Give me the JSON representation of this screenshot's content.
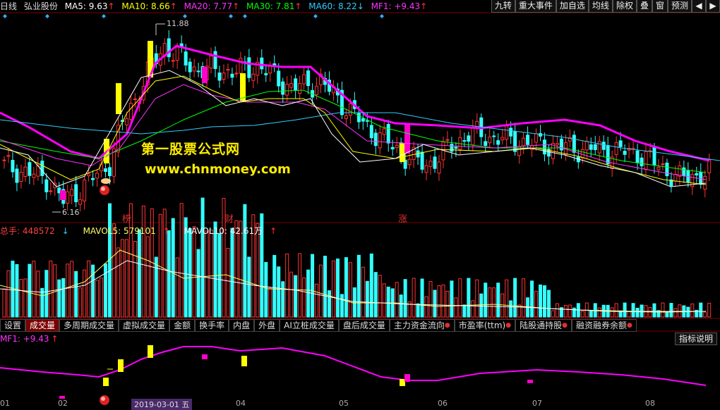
{
  "header": {
    "period": "日线",
    "stock": "弘业股份",
    "ma": [
      {
        "label": "MA5: 9.63",
        "arrow": "↑",
        "color": "#ffffff"
      },
      {
        "label": "MA10: 8.66",
        "arrow": "↑",
        "color": "#ffff00"
      },
      {
        "label": "MA20: 7.77",
        "arrow": "↑",
        "color": "#ff33ff"
      },
      {
        "label": "MA30: 7.81",
        "arrow": "↑",
        "color": "#00ff00"
      },
      {
        "label": "MA60: 8.22",
        "arrow": "↓",
        "color": "#33ccff"
      },
      {
        "label": "MF1: +9.43",
        "arrow": "↑",
        "color": "#ff33ff"
      }
    ]
  },
  "toolbar": {
    "jiuzhuan": "九转",
    "events": "重大事件",
    "add": "加自选",
    "ma_line": "均线",
    "exright": "除权",
    "overlay": "叠",
    "window": "窗",
    "alert": "预测",
    "left_arrow": "◀",
    "right_arrow": "▶"
  },
  "price_labels": {
    "high": "11.88",
    "low": "6.16"
  },
  "tags": {
    "bang": "榜",
    "cai": "财",
    "zhang": "涨"
  },
  "watermark": {
    "line1": "第一股票公式网",
    "line2": "www.chnmoney.com"
  },
  "volume": {
    "total": "总手: 448572",
    "total_arrow": "↓",
    "mavol5": "MAVOL5: 579101",
    "mavol5_arrow": "↑",
    "mavol10": "MAVOL10: 42.61万",
    "mavol10_arrow": "↑"
  },
  "tabs": [
    {
      "label": "设置",
      "dot": false
    },
    {
      "label": "成交量",
      "dot": false,
      "active": true
    },
    {
      "label": "多周期成交量",
      "dot": false
    },
    {
      "label": "虚拟成交量",
      "dot": false
    },
    {
      "label": "金额",
      "dot": false
    },
    {
      "label": "换手率",
      "dot": false
    },
    {
      "label": "内盘",
      "dot": false
    },
    {
      "label": "外盘",
      "dot": false
    },
    {
      "label": "AI立桩成交量",
      "dot": false
    },
    {
      "label": "盘后成交量",
      "dot": false
    },
    {
      "label": "主力资金流向",
      "dot": true
    },
    {
      "label": "市盈率(ttm)",
      "dot": true
    },
    {
      "label": "陆股通持股",
      "dot": true
    },
    {
      "label": "融资融券余额",
      "dot": true
    }
  ],
  "mf": {
    "label": "MF1: +9.43",
    "arrow": "↑"
  },
  "explain": "指标说明",
  "dates": [
    "01",
    "02",
    "2019-03-01 五",
    "04",
    "05",
    "06",
    "07",
    "08"
  ],
  "colors": {
    "up": "#ff3333",
    "down": "#33ffff",
    "ma5": "#ffffff",
    "ma10": "#ffff00",
    "ma20": "#ff33ff",
    "ma30": "#00ff00",
    "ma60": "#33ccff"
  }
}
